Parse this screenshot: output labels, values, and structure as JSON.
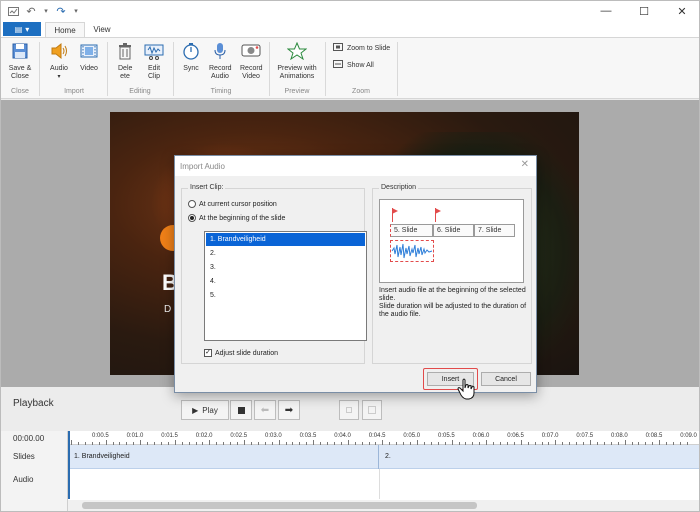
{
  "tabs": {
    "home": "Home",
    "view": "View"
  },
  "ribbon": {
    "save_close": "Save & Close",
    "audio": "Audio",
    "video": "Video",
    "delete": "Dele ete",
    "edit_clip": "Edit Clip",
    "sync": "Sync",
    "record_audio": "Record Audio",
    "record_video": "Record Video",
    "preview_animations": "Preview with Animations",
    "zoom_to_slide": "Zoom to Slide",
    "show_all": "Show All",
    "groups": {
      "close": "Close",
      "import": "Import",
      "editing": "Editing",
      "timing": "Timing",
      "preview": "Preview",
      "zoom": "Zoom"
    }
  },
  "slide": {
    "big": "B",
    "small": "D"
  },
  "dialog": {
    "title": "Import Audio",
    "insert_clip_legend": "Insert Clip:",
    "opt_cursor": "At current cursor position",
    "opt_beginning": "At the beginning of the slide",
    "list_items": [
      "1. Brandveiligheid",
      "2.",
      "3.",
      "4.",
      "5."
    ],
    "adjust_duration": "Adjust slide duration",
    "description_legend": "Description",
    "preview_slides": [
      "5. Slide",
      "6. Slide",
      "7. Slide"
    ],
    "description_text": "Insert audio file at the beginning of the selected slide.\nSlide duration will be adjusted to the duration of the audio file.",
    "insert_btn": "Insert",
    "cancel_btn": "Cancel"
  },
  "playback": {
    "title": "Playback",
    "play": "Play"
  },
  "timeline": {
    "time": "00:00.00",
    "slides_label": "Slides",
    "audio_label": "Audio",
    "ticks": [
      "0:00.5",
      "0:01.0",
      "0:01.5",
      "0:02.0",
      "0:02.5",
      "0:03.0",
      "0:03.5",
      "0:04.0",
      "0:04.5",
      "0:05.0",
      "0:05.5",
      "0:06.0",
      "0:06.5",
      "0:07.0",
      "0:07.5",
      "0:08.0",
      "0:08.5",
      "0:09.0"
    ],
    "slide_cells": [
      "1. Brandveiligheid",
      "2."
    ]
  },
  "colors": {
    "accent": "#1d6fc1",
    "selection": "#0a64d6",
    "highlight": "#e24b4b"
  }
}
